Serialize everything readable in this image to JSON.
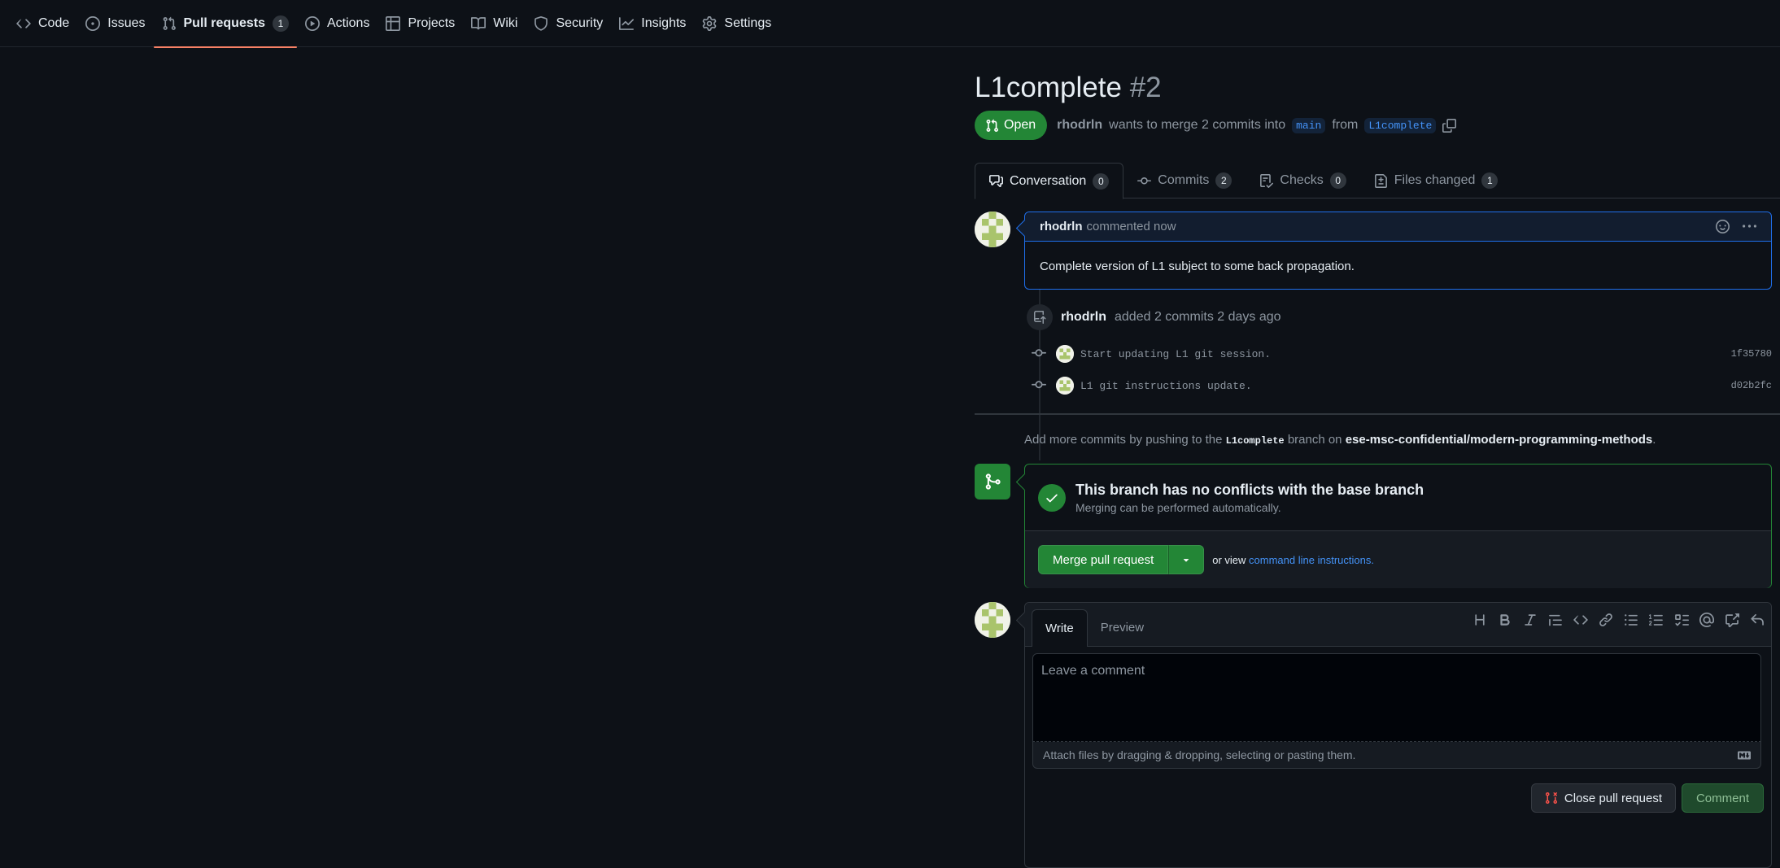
{
  "nav": {
    "items": [
      {
        "label": "Code",
        "icon": "code-icon"
      },
      {
        "label": "Issues",
        "icon": "issue-icon"
      },
      {
        "label": "Pull requests",
        "icon": "pull-request-icon",
        "count": "1",
        "active": true
      },
      {
        "label": "Actions",
        "icon": "play-icon"
      },
      {
        "label": "Projects",
        "icon": "table-icon"
      },
      {
        "label": "Wiki",
        "icon": "book-icon"
      },
      {
        "label": "Security",
        "icon": "shield-icon"
      },
      {
        "label": "Insights",
        "icon": "graph-icon"
      },
      {
        "label": "Settings",
        "icon": "gear-icon"
      }
    ]
  },
  "pr": {
    "title": "L1complete",
    "number": "#2",
    "state": "Open",
    "author": "rhodrln",
    "merge_text_1": "wants to merge 2 commits into",
    "base_branch": "main",
    "from_text": "from",
    "head_branch": "L1complete"
  },
  "tabs": [
    {
      "label": "Conversation",
      "count": "0",
      "icon": "comment-discussion-icon"
    },
    {
      "label": "Commits",
      "count": "2",
      "icon": "commit-icon"
    },
    {
      "label": "Checks",
      "count": "0",
      "icon": "checklist-icon"
    },
    {
      "label": "Files changed",
      "count": "1",
      "icon": "file-diff-icon"
    }
  ],
  "comment": {
    "author": "rhodrln",
    "meta": "commented now",
    "body": "Complete version of L1 subject to some back propagation."
  },
  "event": {
    "author": "rhodrln",
    "text": "added 2 commits 2 days ago"
  },
  "commits": [
    {
      "message": "Start updating L1 git session.",
      "sha": "1f35780"
    },
    {
      "message": "L1 git instructions update.",
      "sha": "d02b2fc"
    }
  ],
  "push_hint": {
    "pre": "Add more commits by pushing to the",
    "branch": "L1complete",
    "mid": "branch on",
    "repo": "ese-msc-confidential/modern-programming-methods",
    "post": "."
  },
  "merge": {
    "title": "This branch has no conflicts with the base branch",
    "subtitle": "Merging can be performed automatically.",
    "button": "Merge pull request",
    "or_view": "or view",
    "link": "command line instructions",
    "link_post": "."
  },
  "composer": {
    "write_tab": "Write",
    "preview_tab": "Preview",
    "placeholder": "Leave a comment",
    "attach_text": "Attach files by dragging & dropping, selecting or pasting them.",
    "close_button": "Close pull request",
    "comment_button": "Comment"
  },
  "colors": {
    "background": "#0d1117",
    "accent_green": "#238636",
    "link_blue": "#4493f8",
    "nav_underline": "#f78166"
  }
}
